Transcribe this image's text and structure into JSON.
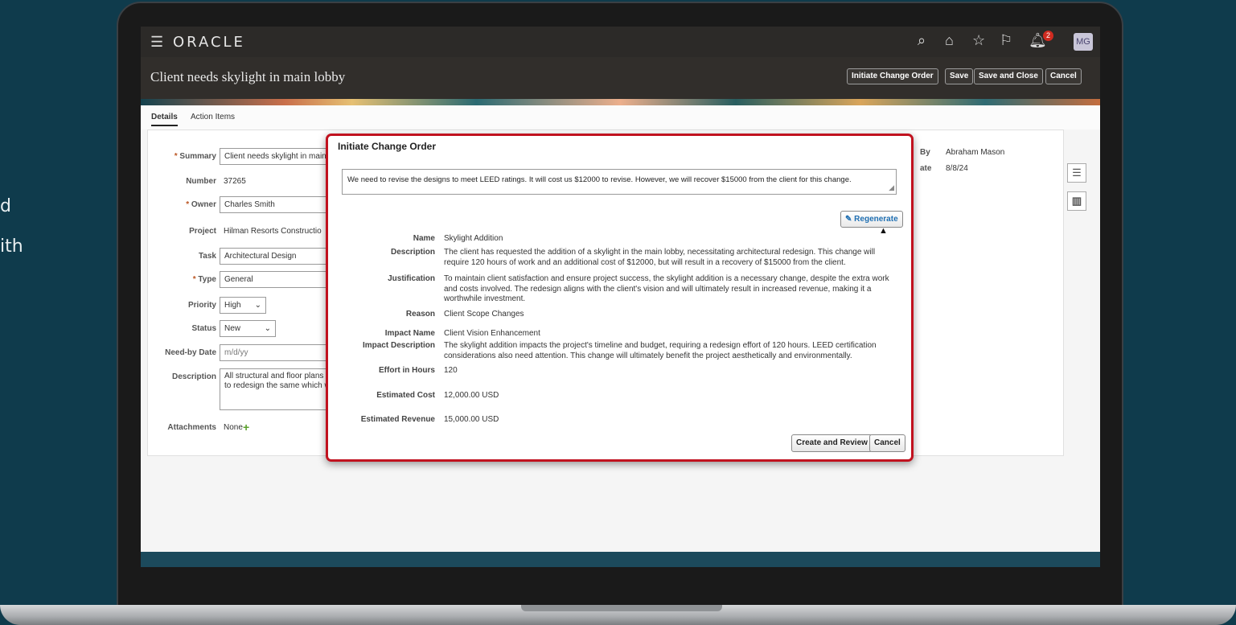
{
  "side_text": {
    "line1": "d",
    "line2": "ith"
  },
  "app": {
    "brand": "ORACLE",
    "avatar": "MG",
    "notifications": "2"
  },
  "header": {
    "title": "Client needs skylight in main lobby",
    "buttons": {
      "initiate": "Initiate Change Order",
      "save": "Save",
      "save_close": "Save and Close",
      "cancel": "Cancel"
    }
  },
  "tabs": {
    "details": "Details",
    "action_items": "Action Items"
  },
  "form": {
    "summary_label": "Summary",
    "summary_value": "Client needs skylight in main l",
    "number_label": "Number",
    "number_value": "37265",
    "owner_label": "Owner",
    "owner_value": "Charles Smith",
    "project_label": "Project",
    "project_value": "Hilman Resorts Constructio",
    "task_label": "Task",
    "task_value": "Architectural Design",
    "type_label": "Type",
    "type_value": "General",
    "priority_label": "Priority",
    "priority_value": "High",
    "status_label": "Status",
    "status_value": "New",
    "needby_label": "Need-by Date",
    "needby_placeholder": "m/d/yy",
    "description_label": "Description",
    "description_value": "All structural and floor plans a to redesign the same which w",
    "attachments_label": "Attachments",
    "attachments_value": "None"
  },
  "right_info": {
    "by_label": "By",
    "by_value": "Abraham Mason",
    "date_label": "ate",
    "date_value": "8/8/24"
  },
  "modal": {
    "title": "Initiate Change Order",
    "prompt": "We need to revise the designs to meet LEED ratings. It will cost us $12000 to revise. However, we will recover $15000 from the client for this change.",
    "regenerate": "Regenerate",
    "fields": {
      "name_label": "Name",
      "name_value": "Skylight Addition",
      "description_label": "Description",
      "description_value": "The client has requested the addition of a skylight in the main lobby, necessitating architectural redesign. This change will require 120 hours of work and an additional cost of $12000, but will result in a recovery of $15000 from the client.",
      "justification_label": "Justification",
      "justification_value": "To maintain client satisfaction and ensure project success, the skylight addition is a necessary change, despite the extra work and costs involved. The redesign aligns with the client's vision and will ultimately result in increased revenue, making it a worthwhile investment.",
      "reason_label": "Reason",
      "reason_value": "Client Scope Changes",
      "impact_name_label": "Impact Name",
      "impact_name_value": "Client Vision Enhancement",
      "impact_desc_label": "Impact Description",
      "impact_desc_value": "The skylight addition impacts the project's timeline and budget, requiring a redesign effort of 120 hours. LEED certification considerations also need attention. This change will ultimately benefit the project aesthetically and environmentally.",
      "effort_label": "Effort in Hours",
      "effort_value": "120",
      "cost_label": "Estimated Cost",
      "cost_value": "12,000.00 USD",
      "revenue_label": "Estimated Revenue",
      "revenue_value": "15,000.00 USD"
    },
    "create_review": "Create and Review",
    "cancel": "Cancel"
  },
  "colors": {
    "highlight": "#c1121f",
    "header_bg": "#312e2b",
    "background": "#0f3b4c"
  }
}
